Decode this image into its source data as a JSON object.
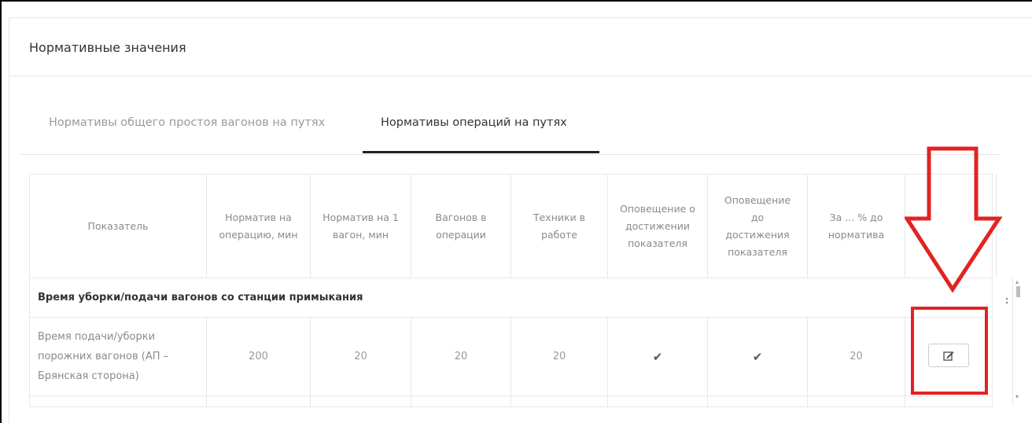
{
  "panel": {
    "title": "Нормативные значения"
  },
  "tabs": [
    {
      "label": "Нормативы общего простоя вагонов на путях",
      "active": false
    },
    {
      "label": "Нормативы операций на путях",
      "active": true
    }
  ],
  "table": {
    "headers": [
      "Показатель",
      "Норматив на операцию, мин",
      "Норматив на 1 вагон, мин",
      "Вагонов в операции",
      "Техники в работе",
      "Оповещение о достижении показателя",
      "Оповещение до достижения показателя",
      "За ... % до норматива",
      ""
    ],
    "group_title": "Время уборки/подачи вагонов со станции примыкания",
    "rows": [
      {
        "name": "Время подачи/уборки порожних вагонов (АП – Брянская сторона)",
        "norm_operation": "200",
        "norm_wagon": "20",
        "wagons": "20",
        "machines": "20",
        "notify_reached": "✔",
        "notify_before": "✔",
        "percent_before": "20"
      }
    ]
  },
  "icons": {
    "edit": "edit-icon",
    "annotation_arrow": "down-arrow-icon"
  },
  "colors": {
    "annotation": "#e32222",
    "active_tab": "#222222"
  }
}
